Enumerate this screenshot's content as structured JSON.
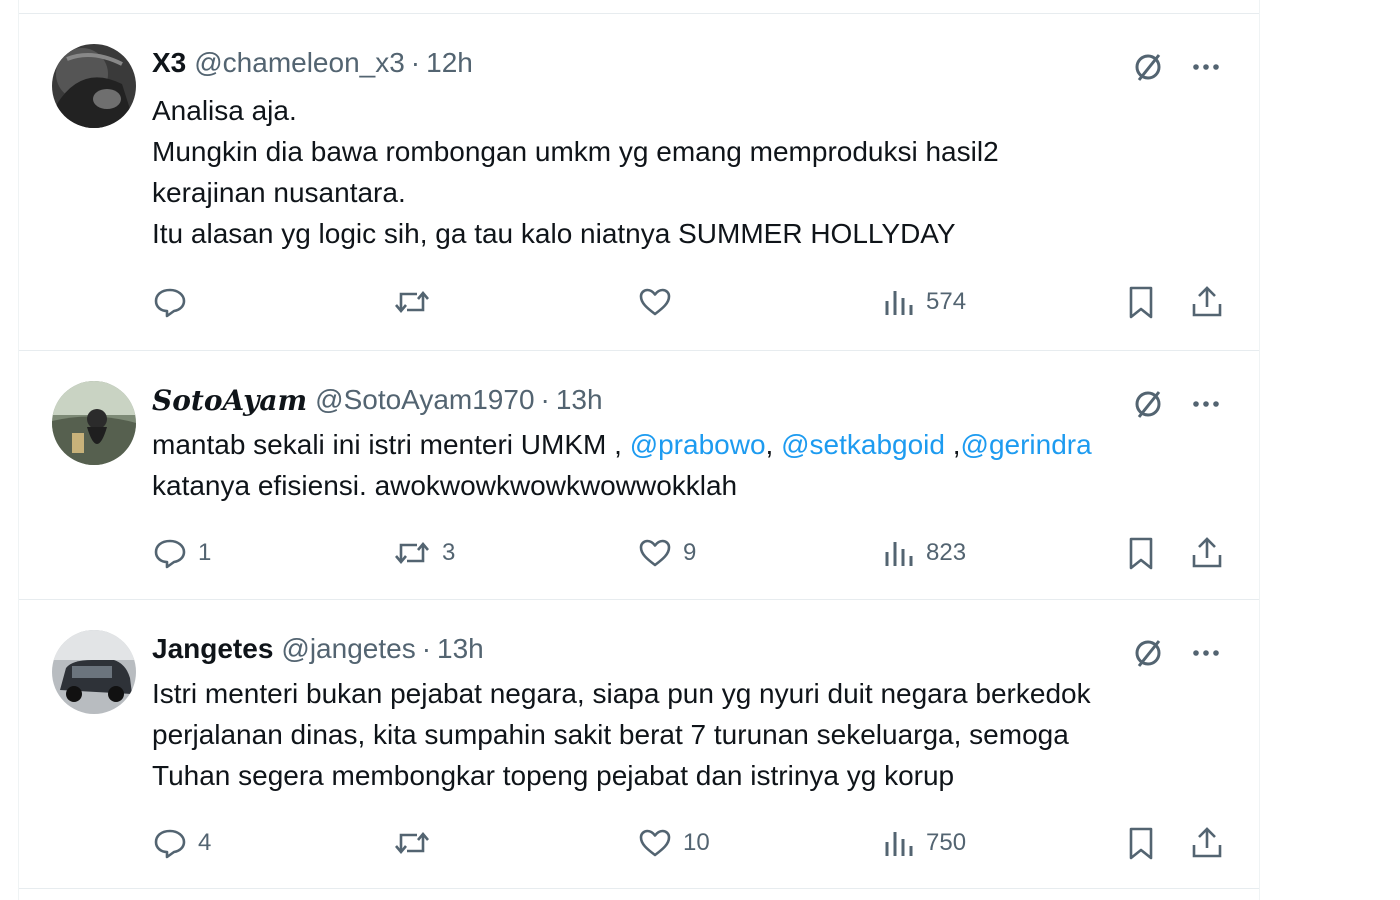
{
  "tweets": [
    {
      "display_name": "X3",
      "handle": "@chameleon_x3",
      "separator": "·",
      "time": "12h",
      "lines": [
        [
          {
            "text": "Analisa aja."
          }
        ],
        [
          {
            "text": "Mungkin dia bawa rombongan umkm yg emang memproduksi hasil2"
          }
        ],
        [
          {
            "text": "kerajinan nusantara."
          }
        ],
        [
          {
            "text": "Itu alasan yg logic sih, ga tau kalo niatnya SUMMER HOLLYDAY"
          }
        ]
      ],
      "replies": "",
      "reposts": "",
      "likes": "",
      "views": "574"
    },
    {
      "display_name": "SotoAyam",
      "handle": "@SotoAyam1970",
      "separator": "·",
      "time": "13h",
      "lines": [
        [
          {
            "text": "mantab sekali ini istri menteri UMKM , "
          },
          {
            "text": "@prabowo",
            "mention": true
          },
          {
            "text": ", "
          },
          {
            "text": "@setkabgoid",
            "mention": true
          },
          {
            "text": " ,"
          },
          {
            "text": "@gerindra",
            "mention": true
          }
        ],
        [
          {
            "text": "katanya efisiensi. awokwowkwowkwowwokklah"
          }
        ]
      ],
      "replies": "1",
      "reposts": "3",
      "likes": "9",
      "views": "823"
    },
    {
      "display_name": "Jangetes",
      "handle": "@jangetes",
      "separator": "·",
      "time": "13h",
      "lines": [
        [
          {
            "text": "Istri menteri bukan pejabat negara, siapa pun yg nyuri duit negara berkedok"
          }
        ],
        [
          {
            "text": "perjalanan dinas, kita sumpahin sakit berat 7 turunan sekeluarga, semoga"
          }
        ],
        [
          {
            "text": "Tuhan segera membongkar topeng pejabat dan istrinya yg korup"
          }
        ]
      ],
      "replies": "4",
      "reposts": "",
      "likes": "10",
      "views": "750"
    }
  ],
  "icons": {
    "grok": "grok-icon",
    "more": "more-icon",
    "reply": "reply-icon",
    "repost": "repost-icon",
    "like": "like-icon",
    "views": "views-icon",
    "bookmark": "bookmark-icon",
    "share": "share-icon"
  },
  "colors": {
    "text": "#0f1419",
    "secondary": "#536471",
    "mention": "#1d9bf0",
    "border": "#e7ecef"
  }
}
